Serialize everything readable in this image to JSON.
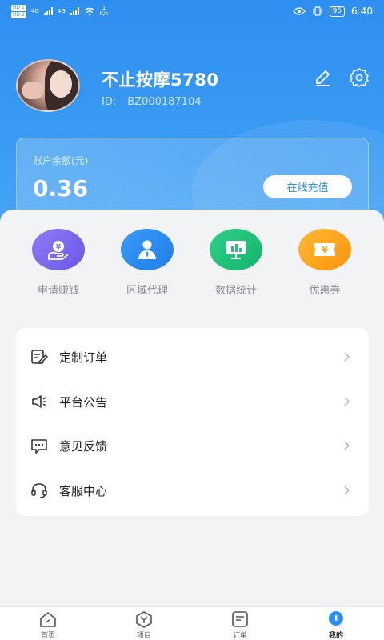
{
  "status_bar": {
    "hd1": "HD 1",
    "hd2": "HD 2",
    "net1": "4G",
    "net2": "4G",
    "speed_value": "1",
    "speed_unit": "K/s",
    "battery": "95",
    "time": "6:40"
  },
  "profile": {
    "name": "不止按摩5780",
    "id_label": "ID:",
    "id_value": "BZ000187104",
    "edit_icon": "edit-icon",
    "settings_icon": "gear-icon"
  },
  "balance": {
    "label": "账户余额(元)",
    "value": "0.36",
    "recharge_label": "在线充值"
  },
  "quick_actions": [
    {
      "label": "申请赚钱",
      "icon": "money-hand-icon",
      "color": "#7b6bf0"
    },
    {
      "label": "区域代理",
      "icon": "agent-person-icon",
      "color": "#2f8ff0"
    },
    {
      "label": "数据统计",
      "icon": "statistics-icon",
      "color": "#1fc27a"
    },
    {
      "label": "优惠券",
      "icon": "coupon-icon",
      "color": "#ffa51f"
    }
  ],
  "menu": [
    {
      "label": "定制订单",
      "icon": "custom-order-icon"
    },
    {
      "label": "平台公告",
      "icon": "announcement-icon"
    },
    {
      "label": "意见反馈",
      "icon": "feedback-icon"
    },
    {
      "label": "客服中心",
      "icon": "headset-icon"
    }
  ],
  "tabbar": [
    {
      "label": "首页",
      "icon": "home-icon"
    },
    {
      "label": "项目",
      "icon": "project-icon"
    },
    {
      "label": "订单",
      "icon": "order-icon"
    },
    {
      "label": "我的",
      "icon": "me-icon",
      "active": true
    }
  ],
  "colors": {
    "brand_blue": "#2f8ff0",
    "background": "#f2f3f5"
  }
}
